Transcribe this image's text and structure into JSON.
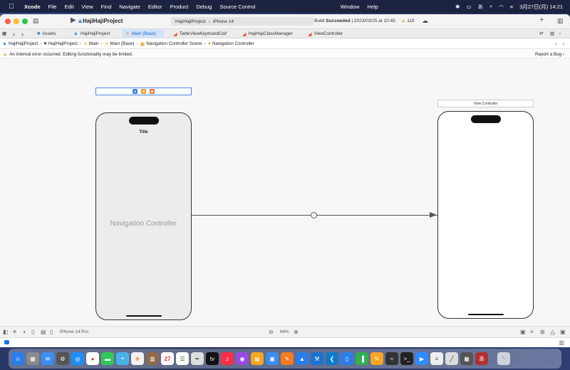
{
  "menubar": {
    "items": [
      "Xcode",
      "File",
      "Edit",
      "View",
      "Find",
      "Navigate",
      "Editor",
      "Product",
      "Debug",
      "Source Control",
      "Window",
      "Help"
    ],
    "status_text": "あ",
    "datetime": "3月27日(月)  14:21"
  },
  "window": {
    "project_title": "HajiHajiProject",
    "scheme": "HajiHajiProject",
    "device": "iPhone 14",
    "build_prefix": "Build",
    "build_status": "Succeeded",
    "build_time": "| 2023/03/25 at 10:45",
    "warnings_count": "119"
  },
  "tabs": [
    {
      "label": "Assets",
      "icon": "folder-icon",
      "icon_color": "#3b82d6"
    },
    {
      "label": "HajiHajiProject",
      "icon": "xcode-project-icon",
      "icon_color": "#3b82d6"
    },
    {
      "label": "Main (Base)",
      "icon": "storyboard-icon",
      "icon_color": "#e8a020"
    },
    {
      "label": "TableViewKeyboardCell",
      "icon": "swift-icon",
      "icon_color": "#f05138"
    },
    {
      "label": "HajiHajiClassManager",
      "icon": "swift-icon",
      "icon_color": "#f05138"
    },
    {
      "label": "ViewController",
      "icon": "swift-icon",
      "icon_color": "#f05138"
    }
  ],
  "jumpbar": [
    "HajiHajiProject",
    "HajiHajiProject",
    "Main",
    "Main (Base)",
    "Navigation Controller Scene",
    "Navigation Controller"
  ],
  "error": {
    "message": "An internal error occurred. Editing functionality may be limited.",
    "report": "Report a Bug"
  },
  "canvas": {
    "nav_title": "Title",
    "nav_label": "Navigation Controller",
    "vc_header": "View Controller"
  },
  "bottombar": {
    "device": "iPhone 14 Pro",
    "zoom": "64%"
  },
  "dock": {
    "calendar_day": "27",
    "apple_tv_label": "tv",
    "japanese_ime_label": "あ"
  }
}
